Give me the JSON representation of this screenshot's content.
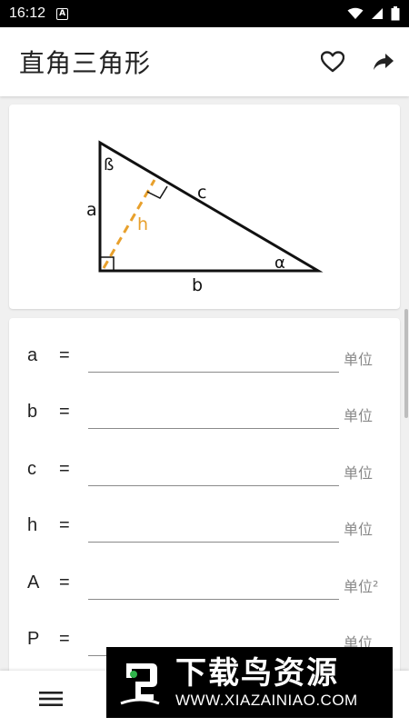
{
  "status_bar": {
    "time": "16:12",
    "notification": "A"
  },
  "app_bar": {
    "title": "直角三角形"
  },
  "diagram": {
    "labels": {
      "a": "a",
      "b": "b",
      "c": "c",
      "h": "h",
      "alpha": "α",
      "beta": "ß"
    },
    "colors": {
      "triangle": "#111111",
      "height": "#e8a02c"
    }
  },
  "fields": [
    {
      "label": "a",
      "eq": "=",
      "value": "",
      "unit": "单位"
    },
    {
      "label": "b",
      "eq": "=",
      "value": "",
      "unit": "单位"
    },
    {
      "label": "c",
      "eq": "=",
      "value": "",
      "unit": "单位"
    },
    {
      "label": "h",
      "eq": "=",
      "value": "",
      "unit": "单位"
    },
    {
      "label": "A",
      "eq": "=",
      "value": "",
      "unit": "单位²"
    },
    {
      "label": "P",
      "eq": "=",
      "value": "",
      "unit": "单位"
    }
  ],
  "watermark": {
    "title": "下载鸟资源",
    "url": "WWW.XIAZAINIAO.COM"
  }
}
